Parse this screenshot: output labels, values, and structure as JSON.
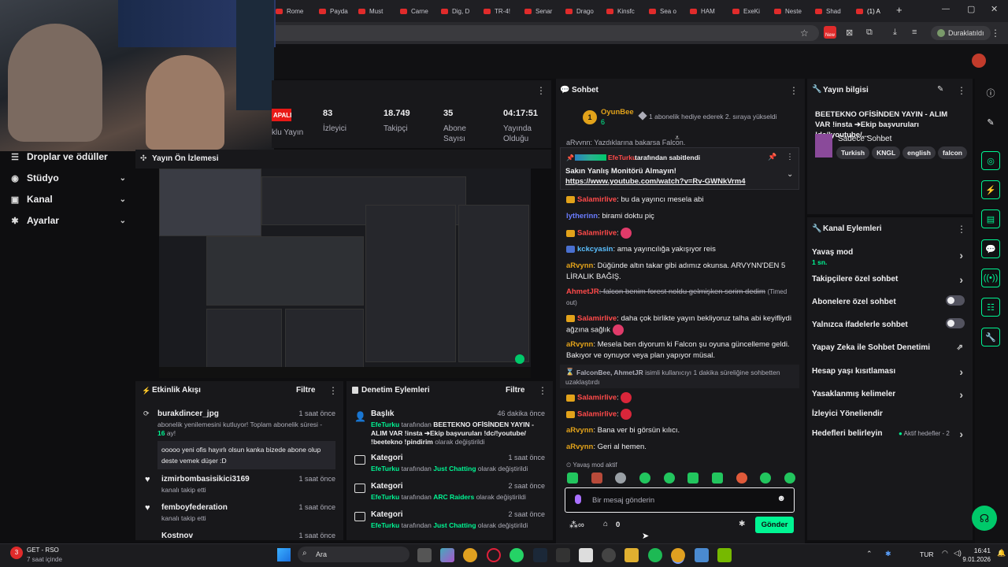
{
  "browser": {
    "tabs": [
      "Rome",
      "Payda",
      "Must",
      "Carne",
      "Dig, D",
      "TR-4!",
      "Senar",
      "Drago",
      "Kinsfc",
      "Sea o",
      "HAM",
      "ExeKi",
      "Neste",
      "Shad",
      "(1) A"
    ],
    "new_tab": "+",
    "profile": "Duraklatıldı",
    "new_badge": "New"
  },
  "nav": [
    {
      "label": "Droplar ve ödüller",
      "icon": "gift-icon"
    },
    {
      "label": "Stüdyo",
      "icon": "studio-icon"
    },
    {
      "label": "Kanal",
      "icon": "channel-icon"
    },
    {
      "label": "Ayarlar",
      "icon": "gear-icon"
    }
  ],
  "stats": {
    "live_badge": "APALI",
    "live_label": "klu Yayın",
    "items": [
      {
        "value": "83",
        "label": "İzleyici"
      },
      {
        "value": "18.749",
        "label": "Takipçi"
      },
      {
        "value": "35",
        "label": "Abone Sayısı"
      },
      {
        "value": "04:17:51",
        "label": "Yayında Olduğu"
      }
    ]
  },
  "preview": {
    "title": "Yayın Ön İzlemesi"
  },
  "activity": {
    "title": "Etkinlik Akışı",
    "filter": "Filtre",
    "items": [
      {
        "user": "burakdincer_jpg",
        "time": "1 saat önce",
        "desc": "abonelik yenilemesini kutluyor! Toplam abonelik süresi -",
        "months": "16",
        "months_suffix": " ay!",
        "quote": "ooooo yeni ofis hayırlı olsun kanka bizede abone olup deste vemek düşer :D"
      },
      {
        "user": "izmirbombasisikici3169",
        "time": "1 saat önce",
        "desc": "kanalı takip etti"
      },
      {
        "user": "femboyfederation",
        "time": "1 saat önce",
        "desc": "kanalı takip etti"
      },
      {
        "user": "Kostnov",
        "time": "1 saat önce",
        "desc": ""
      }
    ]
  },
  "moderation": {
    "title": "Denetim Eylemleri",
    "filter": "Filtre",
    "items": [
      {
        "title": "Başlık",
        "time": "46 dakika önce",
        "actor": "EfeTurku",
        "mid": " tarafından ",
        "value": "BEETEKNO OFİSİNDEN YAYIN - ALIM VAR !insta ➔Ekip başvuruları !dc/!youtube/ !beetekno !pindirim",
        "suffix": " olarak değiştirildi"
      },
      {
        "title": "Kategori",
        "time": "1 saat önce",
        "actor": "EfeTurku",
        "mid": " tarafından ",
        "value": "Just Chatting",
        "suffix": " olarak değiştirildi"
      },
      {
        "title": "Kategori",
        "time": "2 saat önce",
        "actor": "EfeTurku",
        "mid": " tarafından ",
        "value": "ARC Raiders",
        "suffix": " olarak değiştirildi"
      },
      {
        "title": "Kategori",
        "time": "2 saat önce",
        "actor": "EfeTurku",
        "mid": " tarafından ",
        "value": "Just Chatting",
        "suffix": " olarak değiştirildi"
      }
    ]
  },
  "chat": {
    "title": "Sohbet",
    "top_user": "OyunBee",
    "top_count": "6",
    "top_rank": "1",
    "top_text": "1 abonelik hediye ederek 2. sıraya yükseldi",
    "cut_line": "aRvynn: Yazdıklarına bakarsa Falcon.",
    "pinned_by_user": "EfeTurku",
    "pinned_by_text": " tarafından sabitlendi",
    "pinned_text": "Sakın Yanlış Monitörü Almayın!",
    "pinned_link": "https://www.youtube.com/watch?v=Rv-GWNkVrm4",
    "messages": [
      {
        "user": "Salamirlive",
        "text": ": bu da yayıncı mesela abi"
      },
      {
        "user": "lytherinn",
        "text": ": birami doktu piç"
      },
      {
        "user": "Salamirlive",
        "text": ":"
      },
      {
        "user": "kckcyasin",
        "text": ": ama yayıncılığa yakışıyor reis"
      },
      {
        "user": "aRvynn",
        "text": ": Düğünde altın takar gibi adımız okunsa. ARVYNN'DEN 5 LİRALIK BAĞIŞ."
      },
      {
        "user": "AhmetJR",
        "text": ": falcon benim forest noldu gelmişken sorim dedim",
        "note": "(Timed out)"
      },
      {
        "user": "Salamirlive",
        "text": ": daha çok birlikte yayın bekliyoruz talha abi keyifliydi ağzına sağlık"
      },
      {
        "user": "aRvynn",
        "text": ": Mesela ben diyorum ki Falcon şu oyuna güncelleme geldi. Bakıyor ve oynuyor veya plan yapıyor müsal."
      },
      {
        "user": "Salamirlive",
        "text": ":"
      },
      {
        "user": "Salamirlive",
        "text": ":"
      },
      {
        "user": "aRvynn",
        "text": ": Bana ver bi görsün kılıcı."
      },
      {
        "user": "aRvynn",
        "text": ": Geri al hemen."
      }
    ],
    "timeout_users": "FalconBee, AhmetJR",
    "timeout_text": " isimli kullanıcıyı 1 dakika süreliğine sohbetten uzaklaştırdı",
    "slow_mode": "Yavaş mod aktif",
    "input_placeholder": "Bir mesaj gönderin",
    "points": "0",
    "send": "Gönder"
  },
  "stream_info": {
    "title": "Yayın bilgisi",
    "stream_title": "BEETEKNO OFİSİNDEN YAYIN - ALIM VAR !insta ➔Ekip başvuruları !dc/!youtube/...",
    "category": "Sadece Sohbet",
    "tags": [
      "Turkish",
      "KNGL",
      "english",
      "falcon"
    ]
  },
  "channel_actions": {
    "title": "Kanal Eylemleri",
    "items": [
      {
        "label": "Yavaş mod",
        "sub": "1 sn.",
        "kind": "chevron"
      },
      {
        "label": "Takipçilere özel sohbet",
        "kind": "chevron"
      },
      {
        "label": "Abonelere özel sohbet",
        "kind": "toggle"
      },
      {
        "label": "Yalnızca ifadelerle sohbet",
        "kind": "toggle"
      },
      {
        "label": "Yapay Zeka ile Sohbet Denetimi",
        "kind": "external"
      },
      {
        "label": "Hesap yaşı kısıtlaması",
        "kind": "chevron"
      },
      {
        "label": "Yasaklanmış kelimeler",
        "kind": "chevron"
      },
      {
        "label": "İzleyici Yöneliendir",
        "kind": "none"
      },
      {
        "label": "Hedefleri belirleyin",
        "kind": "chevron",
        "extra": "Aktif hedefler - 2"
      }
    ]
  },
  "taskbar": {
    "weather_title": "GET - RSO",
    "weather_sub": "7 saat içinde",
    "weather_badge": "3",
    "search": "Ara",
    "lang": "TUR",
    "time": "16:41",
    "date": "9.01.2026"
  },
  "colors": {
    "accent": "#00f593",
    "bg": "#0e0e10",
    "panel": "#18181b",
    "live": "#e91916",
    "sub_badge": "#e2a21a"
  }
}
